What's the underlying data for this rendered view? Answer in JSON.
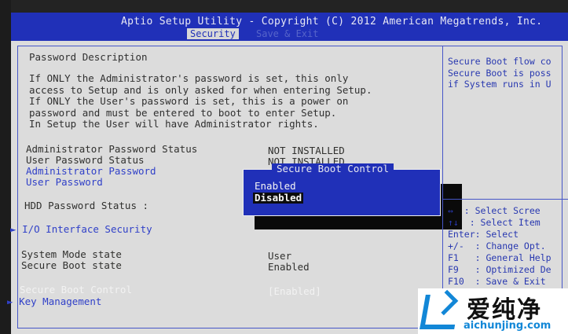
{
  "header": {
    "title": "Aptio Setup Utility - Copyright (C) 2012 American Megatrends, Inc.",
    "tabs": [
      "Security",
      "Save & Exit"
    ]
  },
  "password": {
    "title": "Password Description",
    "description": "If ONLY the Administrator's password is set, this only\naccess to Setup and is only asked for when entering Setup.\nIf ONLY the User's password is set, this is a power on\npassword and must be entered to boot to enter Setup.\nIn Setup the User will have Administrator rights.",
    "admin_status_label": "Administrator Password Status",
    "admin_status_value": "NOT INSTALLED",
    "user_status_label": "User Password Status",
    "user_status_value": "NOT INSTALLED",
    "admin_password_label": "Administrator Password",
    "user_password_label": "User Password",
    "hdd_status_label": "HDD Password Status  :"
  },
  "io_interface_label": "I/O Interface Security",
  "system_mode": {
    "label": "System Mode state",
    "value": "User"
  },
  "secure_boot_state": {
    "label": "Secure Boot state",
    "value": "Enabled"
  },
  "secure_boot_control": {
    "label": "Secure Boot Control",
    "value": "[Enabled]"
  },
  "key_management_label": "Key Management",
  "popup": {
    "title": "Secure Boot Control",
    "options": [
      "Enabled",
      "Disabled"
    ],
    "selected": "Disabled"
  },
  "help": {
    "text": "Secure Boot flow co\nSecure Boot is poss\nif System runs in U",
    "keys": "↔  : Select Scree\n↑↓  : Select Item\nEnter: Select\n+/-  : Change Opt.\nF1   : General Help\nF9   : Optimized De\nF10  : Save & Exit"
  },
  "watermark": {
    "brand": "爱纯净",
    "url": "aichunjing.com"
  },
  "colors": {
    "bios_blue": "#2030b8",
    "panel_gray": "#dcdcdc",
    "logo_blue": "#1287d7"
  }
}
